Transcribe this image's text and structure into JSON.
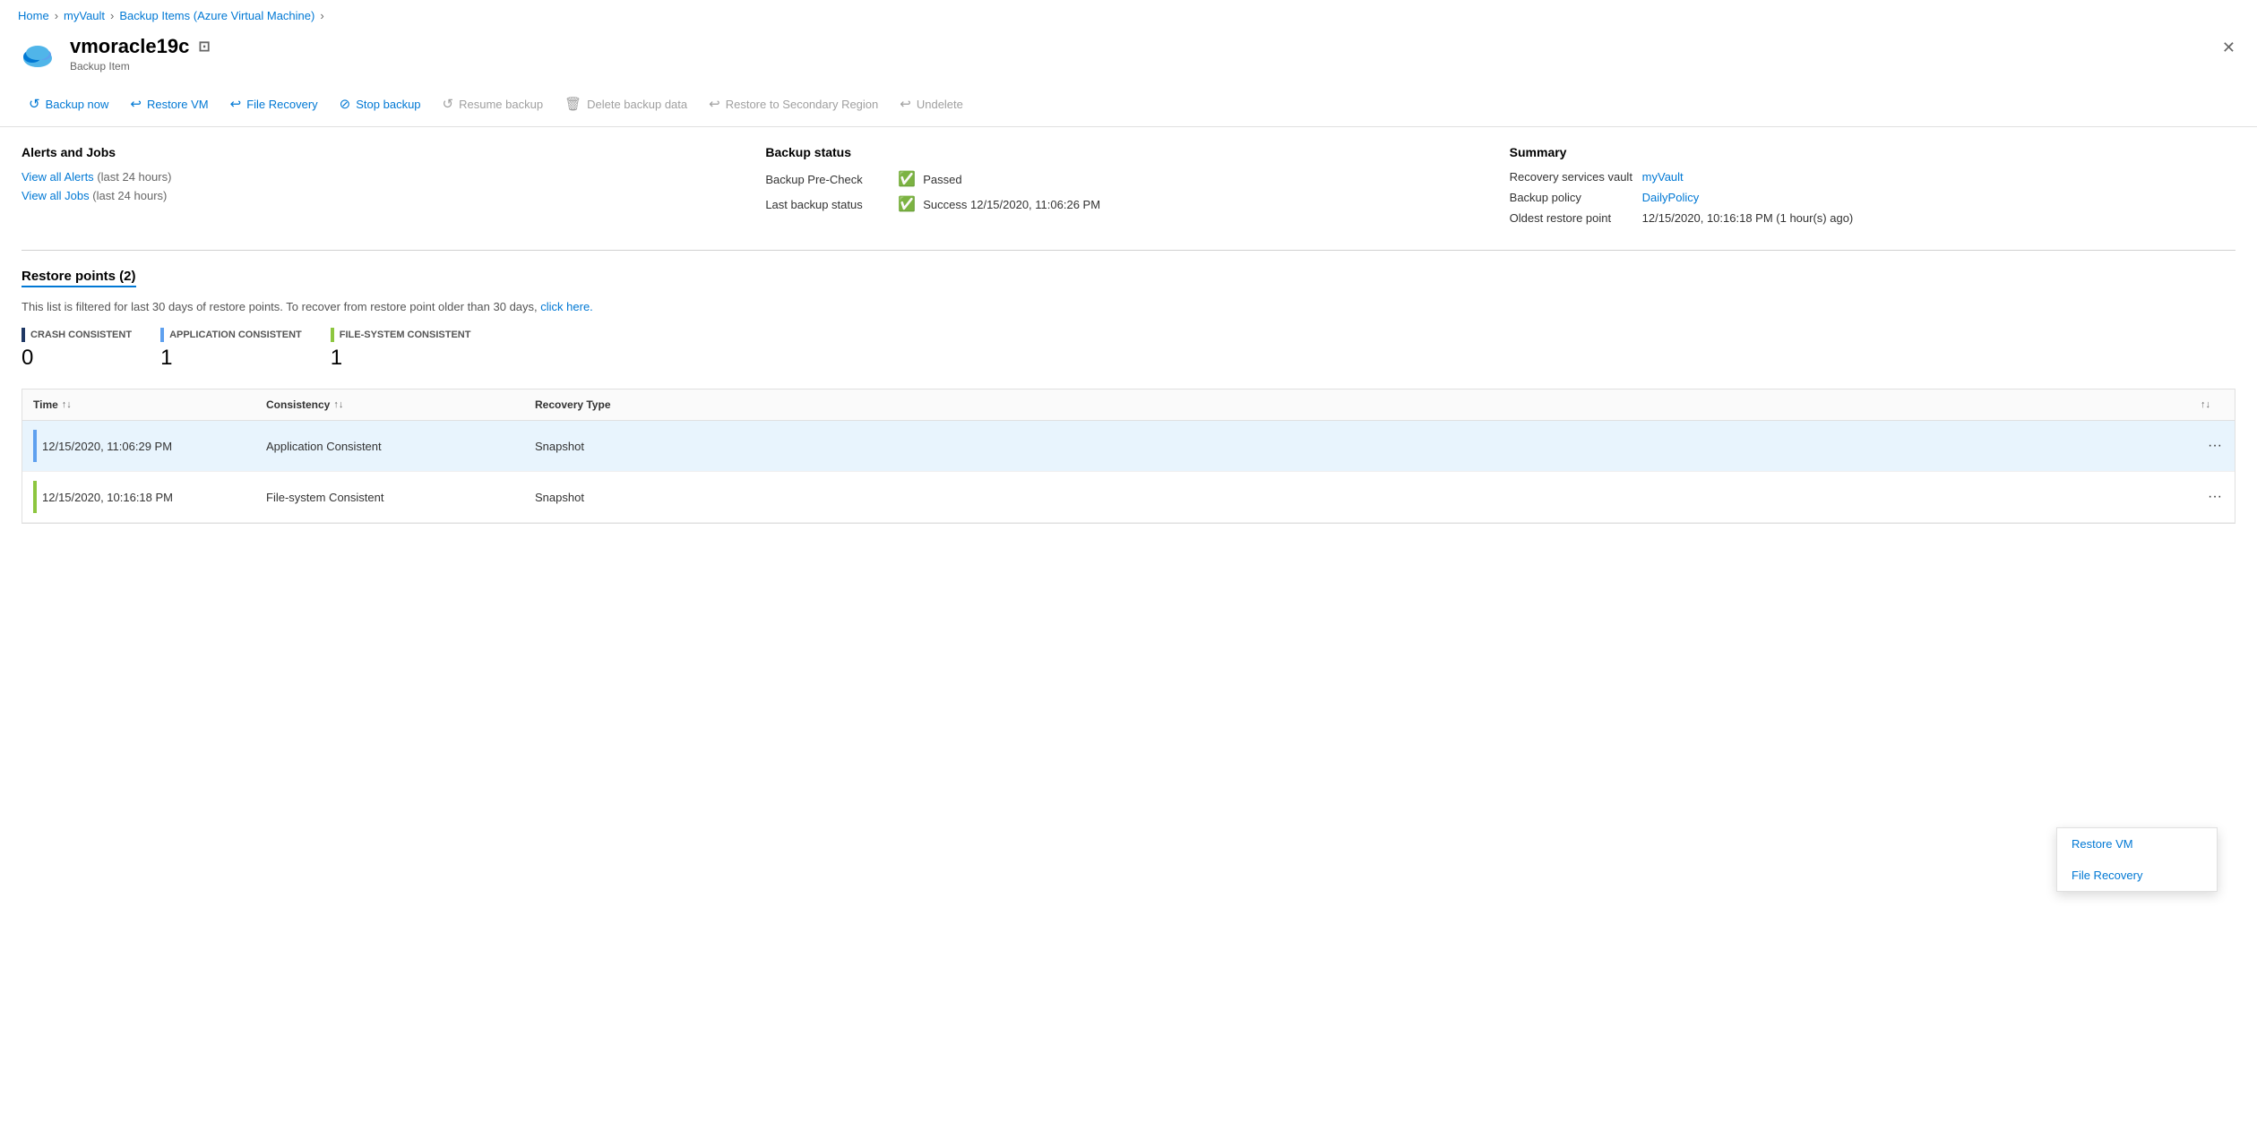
{
  "breadcrumb": {
    "home": "Home",
    "myVault": "myVault",
    "backupItems": "Backup Items (Azure Virtual Machine)"
  },
  "header": {
    "title": "vmoracle19c",
    "subtitle": "Backup Item",
    "close_label": "✕"
  },
  "toolbar": {
    "backup_now": "Backup now",
    "restore_vm": "Restore VM",
    "file_recovery": "File Recovery",
    "stop_backup": "Stop backup",
    "resume_backup": "Resume backup",
    "delete_backup_data": "Delete backup data",
    "restore_secondary": "Restore to Secondary Region",
    "undelete": "Undelete"
  },
  "alerts": {
    "title": "Alerts and Jobs",
    "view_alerts": "View all Alerts",
    "alerts_period": "(last 24 hours)",
    "view_jobs": "View all Jobs",
    "jobs_period": "(last 24 hours)"
  },
  "backup_status": {
    "title": "Backup status",
    "pre_check_label": "Backup Pre-Check",
    "pre_check_value": "Passed",
    "last_status_label": "Last backup status",
    "last_status_value": "Success 12/15/2020, 11:06:26 PM"
  },
  "summary": {
    "title": "Summary",
    "vault_label": "Recovery services vault",
    "vault_value": "myVault",
    "policy_label": "Backup policy",
    "policy_value": "DailyPolicy",
    "restore_point_label": "Oldest restore point",
    "restore_point_value": "12/15/2020, 10:16:18 PM (1 hour(s) ago)"
  },
  "restore_points": {
    "title": "Restore points (2)",
    "filter_text": "This list is filtered for last 30 days of restore points. To recover from restore point older than 30 days,",
    "filter_link": "click here.",
    "crash_consistent_label": "CRASH CONSISTENT",
    "crash_consistent_count": "0",
    "app_consistent_label": "APPLICATION CONSISTENT",
    "app_consistent_count": "1",
    "fs_consistent_label": "FILE-SYSTEM CONSISTENT",
    "fs_consistent_count": "1"
  },
  "table": {
    "col_time": "Time",
    "col_consistency": "Consistency",
    "col_recovery_type": "Recovery Type",
    "rows": [
      {
        "time": "12/15/2020, 11:06:29 PM",
        "consistency": "Application Consistent",
        "recovery_type": "Snapshot",
        "color": "blue",
        "selected": true
      },
      {
        "time": "12/15/2020, 10:16:18 PM",
        "consistency": "File-system Consistent",
        "recovery_type": "Snapshot",
        "color": "yellow-green",
        "selected": false
      }
    ]
  },
  "context_menu": {
    "restore_vm": "Restore VM",
    "file_recovery": "File Recovery"
  }
}
